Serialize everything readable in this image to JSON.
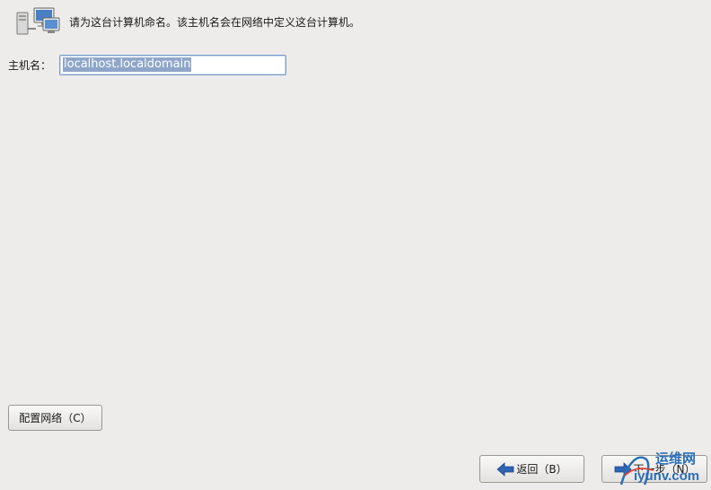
{
  "header": {
    "icon": "network-computers-icon",
    "instruction": "请为这台计算机命名。该主机名会在网络中定义这台计算机。"
  },
  "hostname": {
    "label": "主机名：",
    "value": "localhost.localdomain"
  },
  "buttons": {
    "configure_network": "配置网络（C）",
    "back": "返回（B）",
    "next": "下一步（N）"
  },
  "watermark": {
    "top": "运维网",
    "bottom": "iyunv.com"
  },
  "colors": {
    "background": "#edeceb",
    "selection": "#8fa6c9",
    "arrow": "#2f64b4"
  }
}
